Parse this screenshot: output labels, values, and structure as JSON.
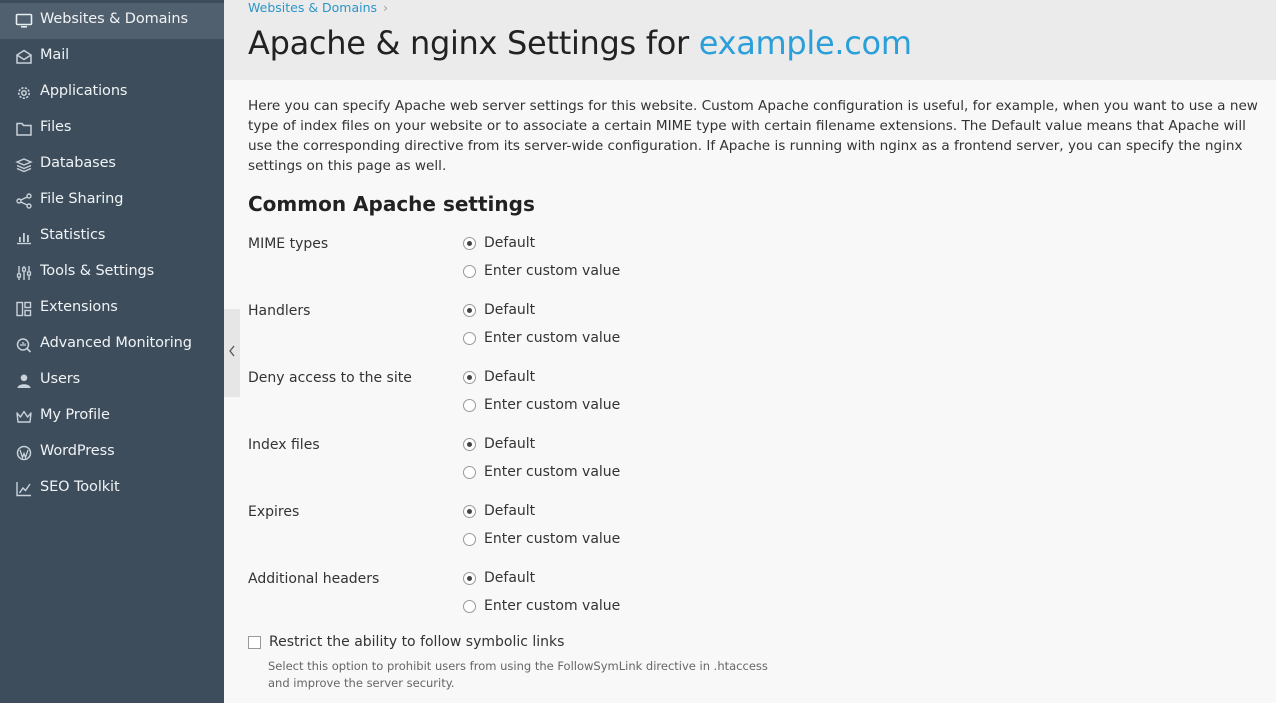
{
  "sidebar": {
    "items": [
      {
        "label": "Websites & Domains",
        "icon": "monitor-icon",
        "active": true
      },
      {
        "label": "Mail",
        "icon": "mail-icon"
      },
      {
        "label": "Applications",
        "icon": "gear-icon"
      },
      {
        "label": "Files",
        "icon": "folder-icon"
      },
      {
        "label": "Databases",
        "icon": "database-icon"
      },
      {
        "label": "File Sharing",
        "icon": "share-icon"
      },
      {
        "label": "Statistics",
        "icon": "bar-chart-icon"
      },
      {
        "label": "Tools & Settings",
        "icon": "sliders-icon"
      },
      {
        "label": "Extensions",
        "icon": "extensions-icon"
      },
      {
        "label": "Advanced Monitoring",
        "icon": "monitoring-icon"
      },
      {
        "label": "Users",
        "icon": "user-icon"
      },
      {
        "label": "My Profile",
        "icon": "crown-icon"
      },
      {
        "label": "WordPress",
        "icon": "wordpress-icon"
      },
      {
        "label": "SEO Toolkit",
        "icon": "seo-chart-icon"
      }
    ]
  },
  "header": {
    "breadcrumb": "Websites & Domains",
    "breadcrumb_sep": "›",
    "title_prefix": "Apache & nginx Settings for ",
    "title_domain": "example.com"
  },
  "intro": "Here you can specify Apache web server settings for this website. Custom Apache configuration is useful, for example, when you want to use a new type of index files on your website or to associate a certain MIME type with certain filename extensions. The Default value means that Apache will use the corresponding directive from its server-wide configuration. If Apache is running with nginx as a frontend server, you can specify the nginx settings on this page as well.",
  "section_title": "Common Apache settings",
  "fields": [
    {
      "label": "MIME types",
      "option_default": "Default",
      "option_custom": "Enter custom value",
      "selected": "default"
    },
    {
      "label": "Handlers",
      "option_default": "Default",
      "option_custom": "Enter custom value",
      "selected": "default"
    },
    {
      "label": "Deny access to the site",
      "option_default": "Default",
      "option_custom": "Enter custom value",
      "selected": "default"
    },
    {
      "label": "Index files",
      "option_default": "Default",
      "option_custom": "Enter custom value",
      "selected": "default"
    },
    {
      "label": "Expires",
      "option_default": "Default",
      "option_custom": "Enter custom value",
      "selected": "default"
    },
    {
      "label": "Additional headers",
      "option_default": "Default",
      "option_custom": "Enter custom value",
      "selected": "default"
    }
  ],
  "symlinks": {
    "label": "Restrict the ability to follow symbolic links",
    "checked": false,
    "hint": "Select this option to prohibit users from using the FollowSymLink directive in .htaccess and improve the server security."
  },
  "colors": {
    "sidebar_bg": "#3d4d5c",
    "sidebar_active": "#51606e",
    "accent": "#2b9fd9",
    "header_bg": "#ebebeb"
  }
}
